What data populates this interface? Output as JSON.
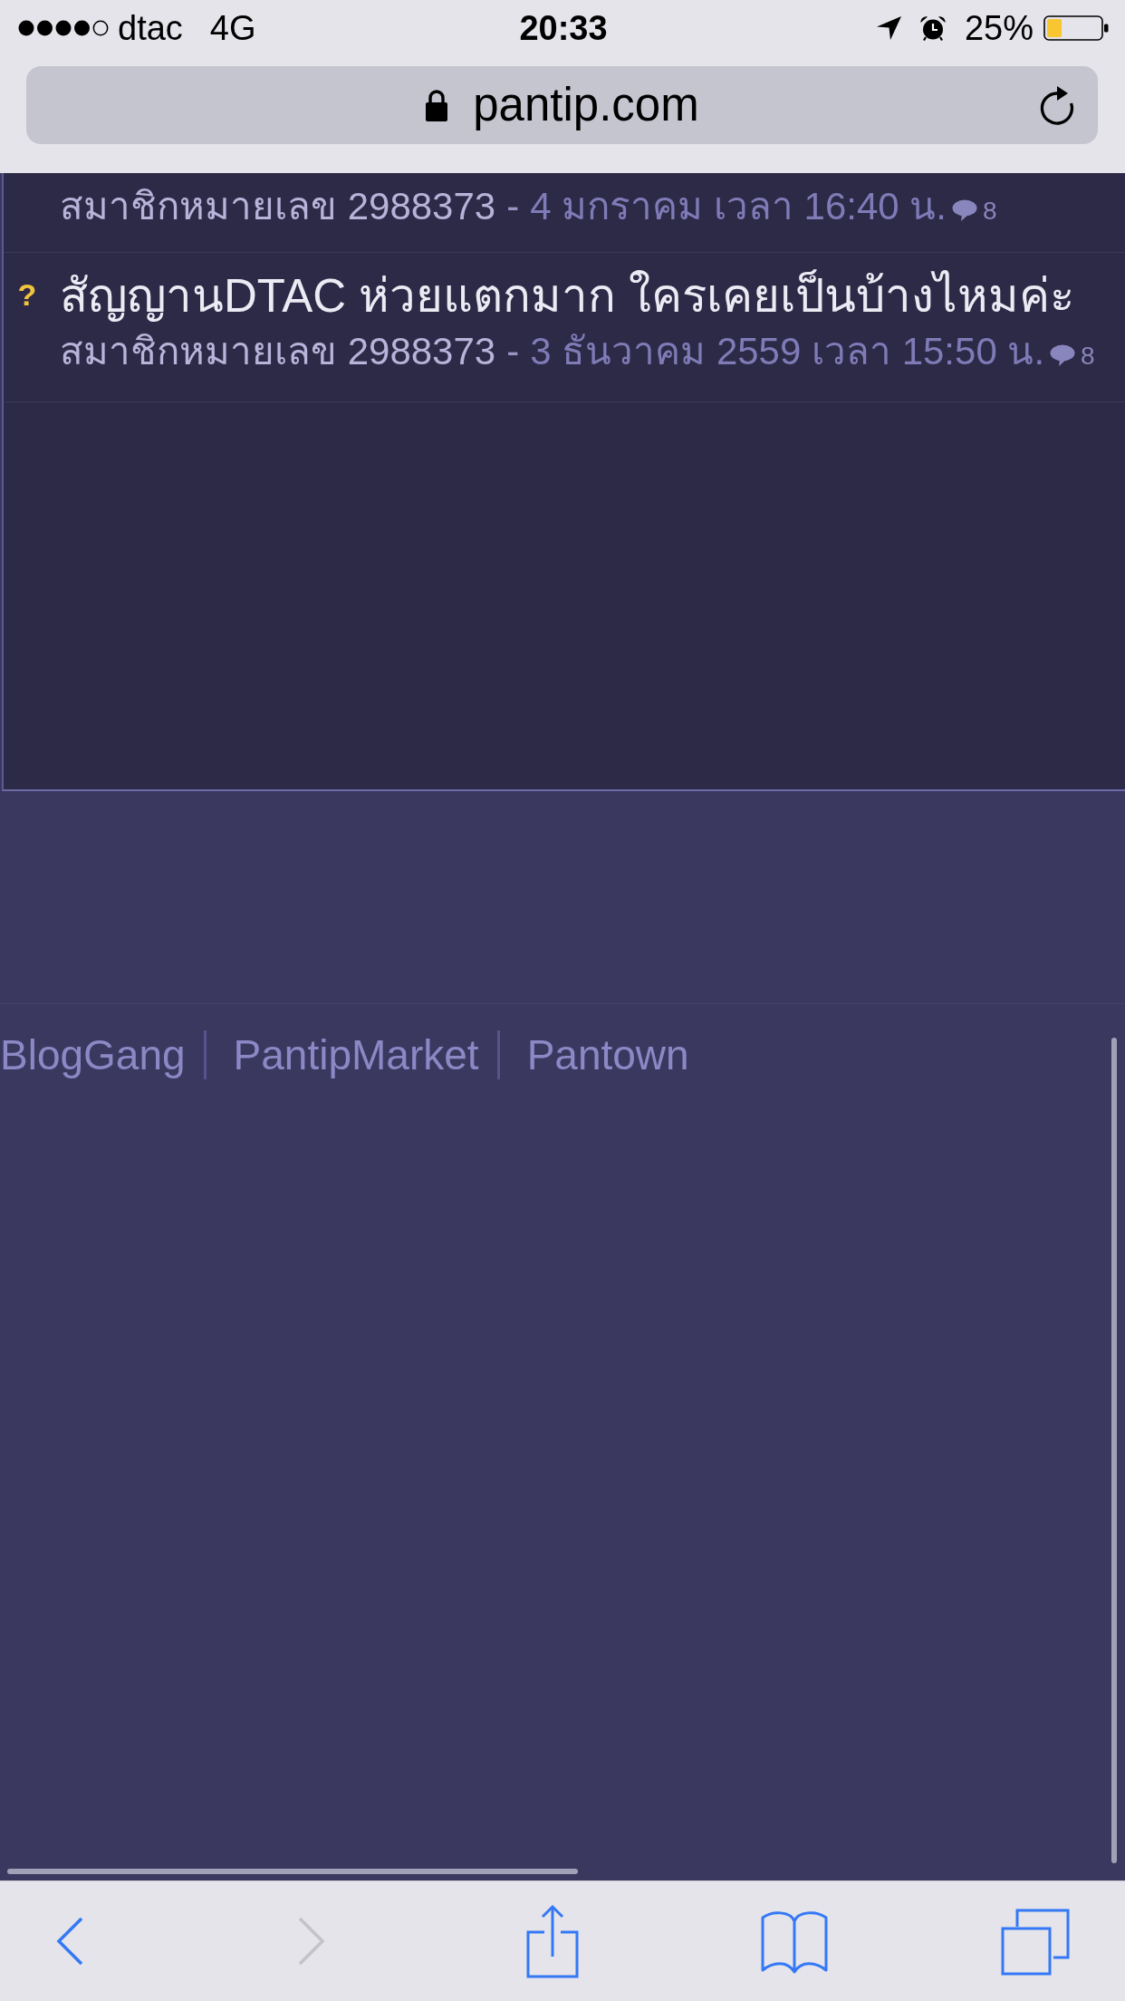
{
  "status_bar": {
    "carrier": "dtac",
    "network": "4G",
    "time": "20:33",
    "battery": "25%"
  },
  "address_bar": {
    "url": "pantip.com",
    "secure": true
  },
  "topics": [
    {
      "author": "สมาชิกหมายเลข 2988373",
      "separator": "-",
      "date": "4 มกราคม เวลา 16:40 น.",
      "comments": "8"
    },
    {
      "marker": "?",
      "title": "สัญญานDTAC ห่วยแตกมาก ใครเคยเป็นบ้างไหมค่ะ",
      "author": "สมาชิกหมายเลข 2988373",
      "separator": "-",
      "date": "3 ธันวาคม 2559 เวลา 15:50 น.",
      "comments": "8"
    }
  ],
  "footer_links": [
    "BlogGang",
    "PantipMarket",
    "Pantown"
  ],
  "toolbar": [
    {
      "kind": "back",
      "disabled": false
    },
    {
      "kind": "forward",
      "disabled": true
    },
    {
      "kind": "share",
      "disabled": false
    },
    {
      "kind": "bookmarks",
      "disabled": false
    },
    {
      "kind": "tabs",
      "disabled": false
    }
  ]
}
